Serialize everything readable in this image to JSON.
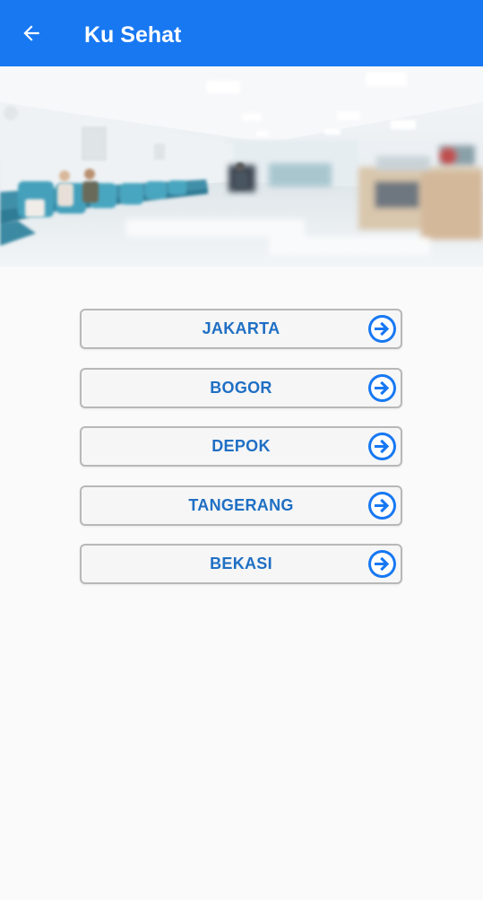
{
  "appbar": {
    "title": "Ku Sehat",
    "back_icon": "arrow-left-icon",
    "color": "#1778f2"
  },
  "hero": {
    "image": "blurred-hospital-waiting-room"
  },
  "cities": [
    {
      "label": "JAKARTA"
    },
    {
      "label": "BOGOR"
    },
    {
      "label": "DEPOK"
    },
    {
      "label": "TANGERANG"
    },
    {
      "label": "BEKASI"
    }
  ],
  "city_button": {
    "icon": "arrow-right-circle-icon",
    "text_color": "#1f6fc4",
    "icon_color": "#1778f2"
  }
}
